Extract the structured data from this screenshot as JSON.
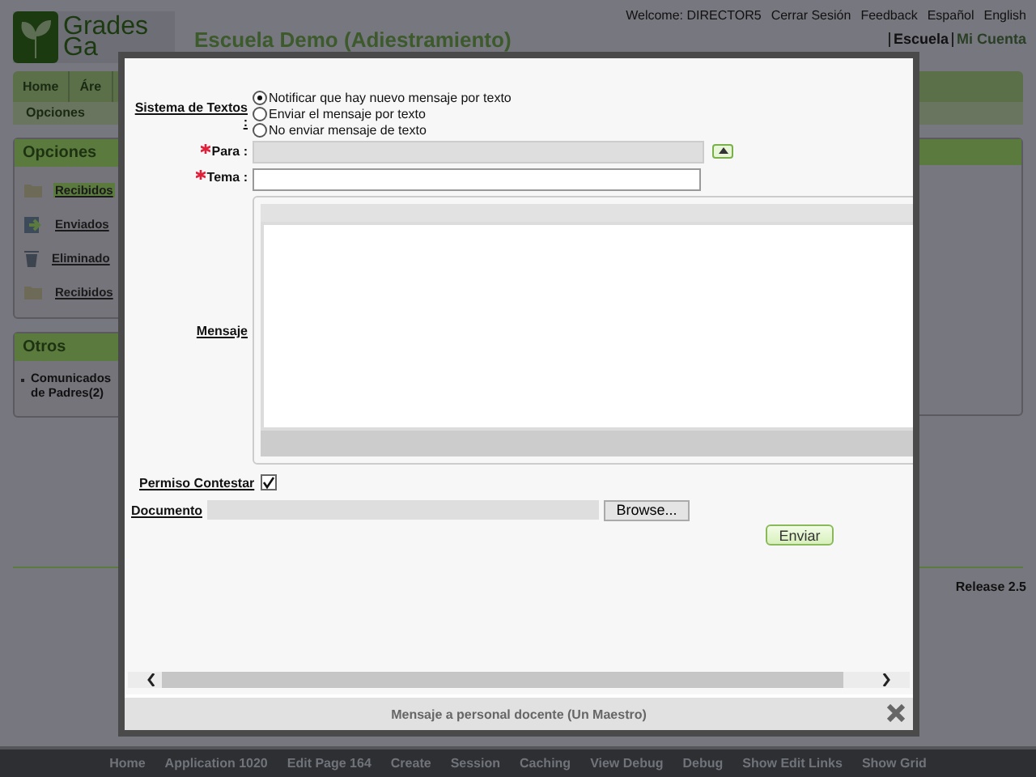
{
  "header": {
    "logo_words": [
      "Grades",
      "Ga"
    ],
    "school_title": "Escuela Demo (Adiestramiento)",
    "top_links": [
      "Welcome: DIRECTOR5",
      "Cerrar Sesión",
      "Feedback",
      "Español",
      "English"
    ],
    "account_links": [
      {
        "label": "Escuela",
        "selected": true
      },
      {
        "label": "Mi Cuenta",
        "selected": false
      }
    ]
  },
  "nav": {
    "items": [
      "Home",
      "Áre"
    ],
    "subnav": [
      "Opciones"
    ]
  },
  "sidebar": {
    "opciones": {
      "title": "Opciones",
      "items": [
        {
          "label": "Recibidos",
          "kind": "folder",
          "selected": true
        },
        {
          "label": "Enviados",
          "kind": "sent",
          "selected": false
        },
        {
          "label": "Eliminado",
          "kind": "trash",
          "selected": false
        },
        {
          "label": "Recibidos",
          "kind": "folder",
          "selected": false
        }
      ]
    },
    "otros": {
      "title": "Otros",
      "items": [
        "Comunicados de Padres(2)"
      ]
    }
  },
  "release": "Release 2.5",
  "dev_bar": [
    "Home",
    "Application 1020",
    "Edit Page 164",
    "Create",
    "Session",
    "Caching",
    "View Debug",
    "Debug",
    "Show Edit Links",
    "Show Grid"
  ],
  "modal": {
    "title": "Mensaje a personal docente (Un Maestro)",
    "sms": {
      "label": "Sistema de Textos :",
      "options": [
        {
          "label": "Notificar que hay nuevo mensaje por texto",
          "selected": true
        },
        {
          "label": "Enviar el mensaje por texto",
          "selected": false
        },
        {
          "label": "No enviar mensaje de texto",
          "selected": false
        }
      ]
    },
    "para": {
      "label": "Para :",
      "required": true
    },
    "tema": {
      "label": "Tema :",
      "required": true
    },
    "mensaje": {
      "label": "Mensaje"
    },
    "permiso": {
      "label": "Permiso Contestar",
      "checked": true
    },
    "documento": {
      "label": "Documento",
      "button": "Browse..."
    },
    "send_button": "Enviar"
  }
}
